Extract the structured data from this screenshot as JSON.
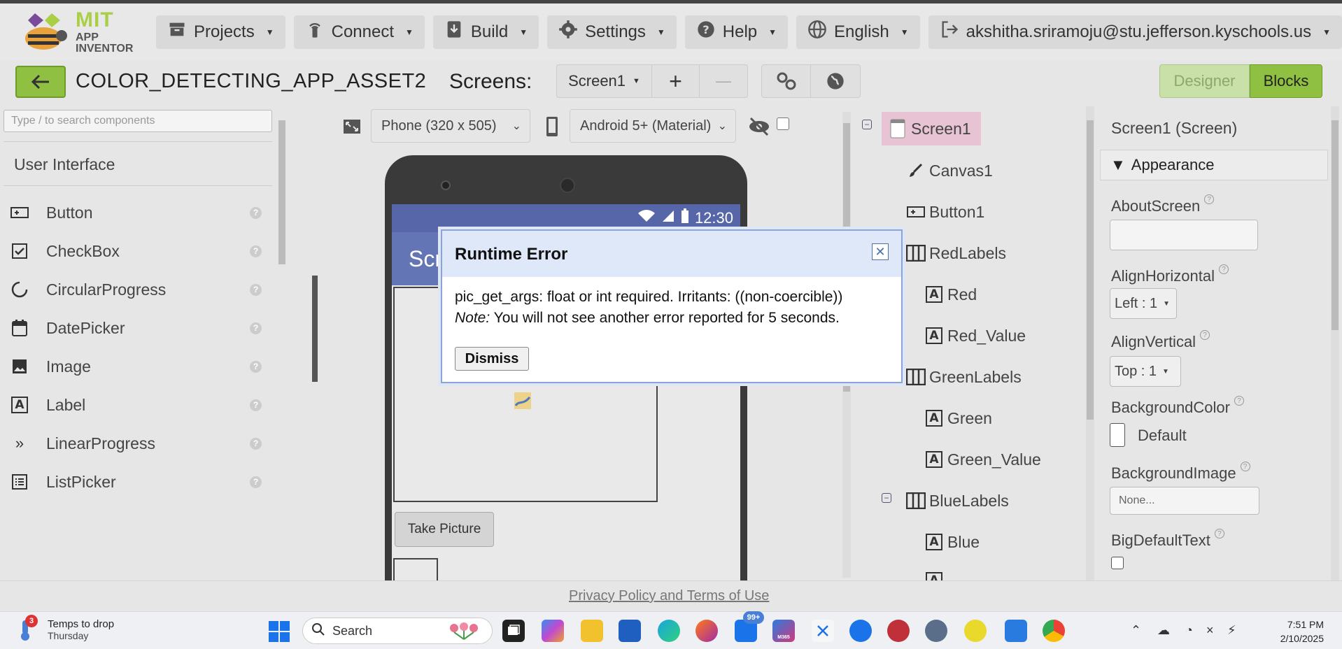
{
  "brand": {
    "name": "MIT",
    "sub": "APP INVENTOR"
  },
  "nav": {
    "projects": "Projects",
    "connect": "Connect",
    "build": "Build",
    "settings": "Settings",
    "help": "Help",
    "language": "English",
    "account": "akshitha.sriramoju@stu.jefferson.kyschools.us"
  },
  "project": {
    "title": "COLOR_DETECTING_APP_ASSET2",
    "screens_label": "Screens:",
    "current_screen": "Screen1",
    "add_symbol": "+",
    "remove_symbol": "—",
    "designer_label": "Designer",
    "blocks_label": "Blocks"
  },
  "palette": {
    "search_placeholder": "Type / to search components",
    "category": "User Interface",
    "items": [
      {
        "label": "Button",
        "icon": "button-icon"
      },
      {
        "label": "CheckBox",
        "icon": "checkbox-icon"
      },
      {
        "label": "CircularProgress",
        "icon": "circular-progress-icon"
      },
      {
        "label": "DatePicker",
        "icon": "calendar-icon"
      },
      {
        "label": "Image",
        "icon": "image-icon"
      },
      {
        "label": "Label",
        "icon": "label-icon"
      },
      {
        "label": "LinearProgress",
        "icon": "chevrons-icon"
      },
      {
        "label": "ListPicker",
        "icon": "list-icon"
      }
    ]
  },
  "viewer": {
    "device_size": "Phone (320 x 505)",
    "theme": "Android 5+ (Material)",
    "status_time": "12:30",
    "screen_title_partial": "Scr",
    "take_picture": "Take Picture"
  },
  "tree": {
    "nodes": [
      {
        "label": "Screen1",
        "icon": "screen-icon"
      },
      {
        "label": "Canvas1",
        "icon": "brush-icon"
      },
      {
        "label": "Button1",
        "icon": "button-icon"
      },
      {
        "label": "RedLabels",
        "icon": "horizontal-arrangement-icon"
      },
      {
        "label": "Red",
        "icon": "label-icon"
      },
      {
        "label": "Red_Value",
        "icon": "label-icon"
      },
      {
        "label": "GreenLabels",
        "icon": "horizontal-arrangement-icon"
      },
      {
        "label": "Green",
        "icon": "label-icon"
      },
      {
        "label": "Green_Value",
        "icon": "label-icon"
      },
      {
        "label": "BlueLabels",
        "icon": "horizontal-arrangement-icon"
      },
      {
        "label": "Blue",
        "icon": "label-icon"
      }
    ]
  },
  "properties": {
    "title": "Screen1 (Screen)",
    "section": "Appearance",
    "about_screen": "AboutScreen",
    "align_horizontal": "AlignHorizontal",
    "align_horizontal_value": "Left : 1",
    "align_vertical": "AlignVertical",
    "align_vertical_value": "Top : 1",
    "background_color": "BackgroundColor",
    "background_color_value": "Default",
    "background_image": "BackgroundImage",
    "background_image_value": "None...",
    "big_default_text": "BigDefaultText"
  },
  "footer": {
    "link": "Privacy Policy and Terms of Use"
  },
  "dialog": {
    "title": "Runtime Error",
    "close_symbol": "✕",
    "message": "pic_get_args: float or int required. Irritants: ((non-coercible))",
    "note_label": "Note:",
    "note_text": " You will not see another error reported for 5 seconds.",
    "dismiss": "Dismiss"
  },
  "taskbar": {
    "weather_badge": "3",
    "weather_line1": "Temps to drop",
    "weather_line2": "Thursday",
    "search_placeholder": "Search",
    "mail_badge": "99+",
    "m365_label": "M365",
    "time": "7:51 PM",
    "date": "2/10/2025"
  },
  "colors": {
    "green_accent": "#8fc041",
    "error_header": "#dfe8f8",
    "phone_status": "#5666a8",
    "phone_title": "#6475b5"
  }
}
